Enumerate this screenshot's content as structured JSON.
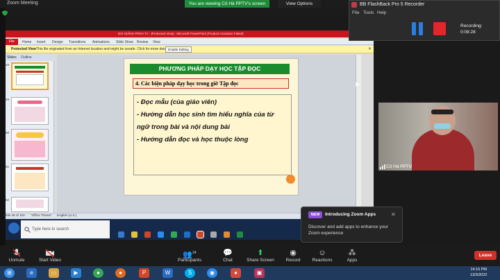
{
  "zoom": {
    "window_title": "Zoom Meeting",
    "share_banner": "You are viewing Cô Hà PPTV's screen",
    "view_options": "View Options",
    "window_controls": "— ▢ ✕",
    "toolbar": [
      {
        "label": "Unmute",
        "icon": "mic-muted-icon"
      },
      {
        "label": "Start Video",
        "icon": "video-off-icon"
      },
      {
        "label": "Participants",
        "icon": "participants-icon",
        "count": "24"
      },
      {
        "label": "Chat",
        "icon": "chat-icon"
      },
      {
        "label": "Share Screen",
        "icon": "share-screen-icon"
      },
      {
        "label": "Record",
        "icon": "record-icon"
      },
      {
        "label": "Reactions",
        "icon": "reactions-icon"
      },
      {
        "label": "Apps",
        "icon": "apps-icon"
      }
    ],
    "leave": "Leave",
    "participant_name": "Cô Hà PPTV",
    "popup": {
      "badge": "NEW",
      "title": "Introducing Zoom Apps",
      "text": "Discover and add apps to enhance your Zoom experience"
    }
  },
  "recorder": {
    "title": "BB FlashBack Pro 5 Recorder",
    "menu": [
      "File",
      "Tools",
      "Help"
    ],
    "recording_label": "Recording:",
    "recording_time": "0:08:28"
  },
  "powerpoint": {
    "title_text": "BÀI GIẢNG PPDH TV - [Protected View] - Microsoft PowerPoint (Product Activation Failed)",
    "file_tab": "File",
    "ribbon_tabs": [
      "Home",
      "Insert",
      "Design",
      "Transitions",
      "Animations",
      "Slide Show",
      "Review",
      "View"
    ],
    "protected_view": {
      "title": "Protected View",
      "message": "This file originated from an Internet location and might be unsafe. Click for more details.",
      "button": "Enable Editing"
    },
    "pane_tabs": [
      "Slides",
      "Outline"
    ],
    "thumb_numbers": [
      "48",
      "49",
      "50",
      "51",
      "52"
    ],
    "slide": {
      "header": "PHƯƠNG PHÁP DẠY HỌC TẬP ĐỌC",
      "subtitle": "4. Các biện pháp dạy học trong giờ Tập đọc",
      "bullets": [
        "- Đọc mẫu (của giáo viên)",
        "- Hướng dẫn học sinh tìm hiểu nghĩa của từ",
        "ngữ trong bài và nội dung bài",
        "- Hướng dẫn đọc và học thuộc lòng"
      ]
    },
    "status": {
      "slide": "Slide 48 of 100",
      "theme": "\"Office Theme\"",
      "language": "English (U.S.)"
    }
  },
  "windows": {
    "search_placeholder": "Type here to search",
    "clock_time": "14:16 PM",
    "clock_date": "13/3/2022"
  },
  "colors": {
    "slide_header_green": "#1a8c2e",
    "ppt_red": "#c9141d",
    "zoom_share_green": "#1e8c3a",
    "leave_red": "#d4302a",
    "recorder_blue": "#2a7de1"
  }
}
